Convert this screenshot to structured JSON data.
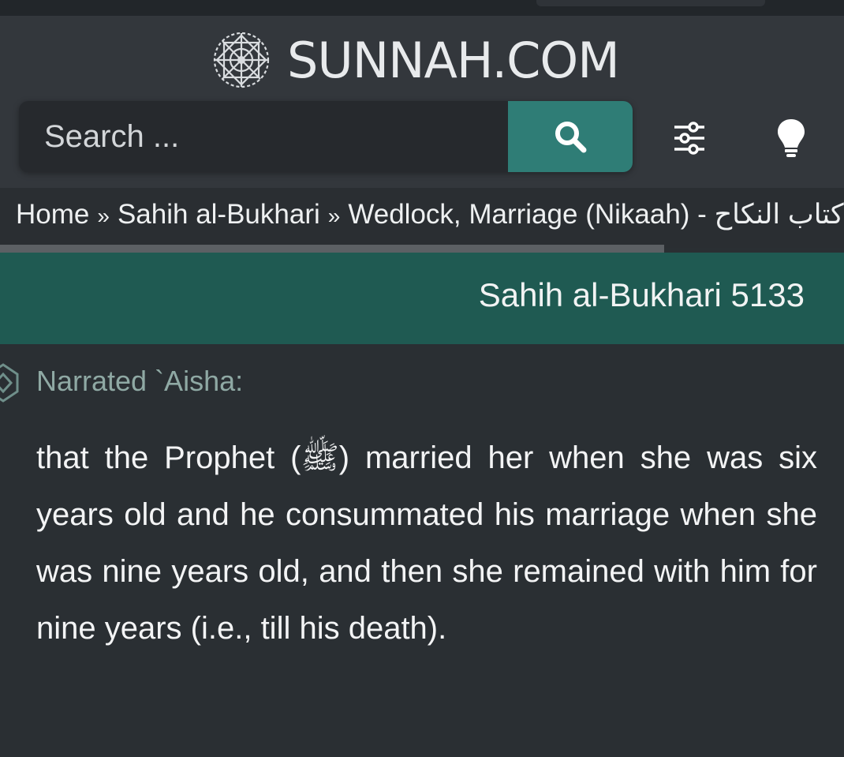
{
  "header": {
    "site_name": "SUNNAH.COM",
    "logo_icon": "ornament-logo-icon"
  },
  "search": {
    "placeholder": "Search ...",
    "value": "",
    "button_icon": "search-icon",
    "accent_color": "#2f7d76"
  },
  "toolbar": {
    "settings_icon": "sliders-icon",
    "theme_icon": "lightbulb-icon"
  },
  "breadcrumb": {
    "items": [
      "Home",
      "Sahih al-Bukhari",
      "Wedlock, Marriage (Nikaah) - كتاب النكاح"
    ],
    "separator": "»"
  },
  "hadith": {
    "reference": "Sahih al-Bukhari 5133",
    "narrator": "Narrated `Aisha:",
    "text": "that the Prophet (ﷺ) married her when she was six years old and he consummated his marriage when she was nine years old, and then she remained with him for nine years (i.e., till his death).",
    "header_color": "#1f5a52"
  }
}
